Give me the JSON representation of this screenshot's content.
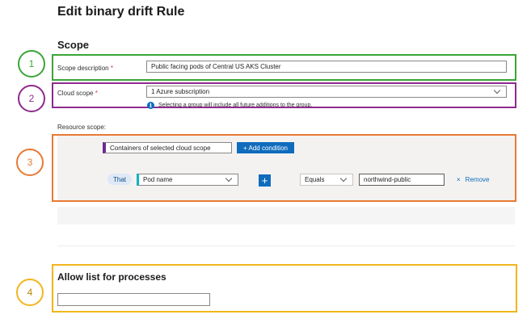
{
  "page": {
    "title": "Edit binary drift Rule",
    "scope_heading": "Scope"
  },
  "callouts": [
    "1",
    "2",
    "3",
    "4"
  ],
  "scope_description": {
    "label": "Scope description",
    "required_mark": "*",
    "value": "Public facing pods of Central US AKS Cluster"
  },
  "cloud_scope": {
    "label": "Cloud scope",
    "required_mark": "*",
    "value": "1 Azure subscription",
    "info_text": "Selecting a group will include all future additions to the group."
  },
  "resource_scope": {
    "label": "Resource scope:",
    "containers_tag": "Containers of selected cloud scope",
    "add_condition": "+ Add condition",
    "condition": {
      "that": "That",
      "field": "Pod name",
      "plus": "+",
      "operator": "Equals",
      "value": "northwind-public",
      "remove_icon": "×",
      "remove_label": "Remove"
    }
  },
  "allow_list": {
    "heading": "Allow list for processes",
    "value": ""
  },
  "colors": {
    "callout_1": "#3aa536",
    "callout_2": "#8e2b8e",
    "callout_3": "#e87934",
    "callout_4": "#f2b61c",
    "accent": "#0f6cbd"
  }
}
